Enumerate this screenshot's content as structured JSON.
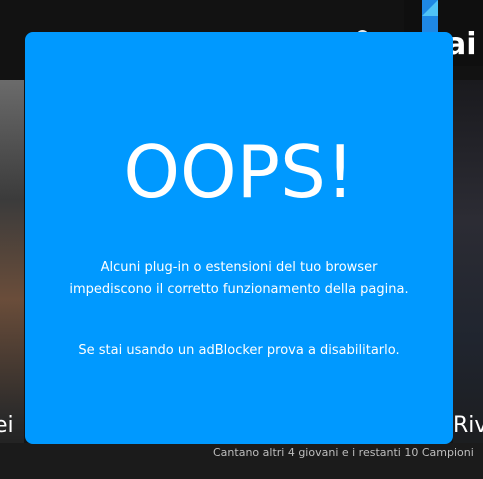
{
  "header": {
    "logo_text": "ai",
    "search_icon": "search-icon"
  },
  "background": {
    "caption_left": "ei",
    "caption_right": "Riv",
    "caption_sub": "Cantano altri 4 giovani e i restanti 10 Campioni"
  },
  "modal": {
    "title": "OOPS!",
    "message": "Alcuni plug-in o estensioni del tuo browser impediscono il corretto funzionamento della pagina.",
    "hint": "Se stai usando un adBlocker prova a disabilitarlo.",
    "color": "#0099ff"
  }
}
